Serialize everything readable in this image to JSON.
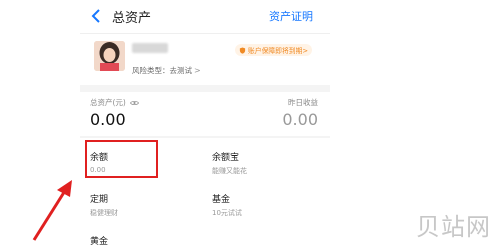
{
  "header": {
    "title": "总资产",
    "right_link": "资产证明"
  },
  "profile": {
    "risk_text": "风险类型：去测试",
    "risk_arrow": ">",
    "badge_text": "账户保障即将到期>"
  },
  "assets": {
    "total_label": "总资产(元)",
    "total_value": "0.00",
    "yesterday_label": "昨日收益",
    "yesterday_value": "0.00"
  },
  "products": [
    {
      "title": "余额",
      "subtitle": "0.00"
    },
    {
      "title": "余额宝",
      "subtitle": "能赚又能花"
    },
    {
      "title": "定期",
      "subtitle": "稳健理财"
    },
    {
      "title": "基金",
      "subtitle": "10元试试"
    },
    {
      "title": "黄金",
      "subtitle": ""
    }
  ],
  "watermark": "贝站网",
  "colors": {
    "accent": "#1677ff",
    "highlight": "#e02020",
    "badge": "#f08a24"
  },
  "icons": [
    "back-arrow-icon",
    "eye-icon",
    "shield-icon"
  ]
}
